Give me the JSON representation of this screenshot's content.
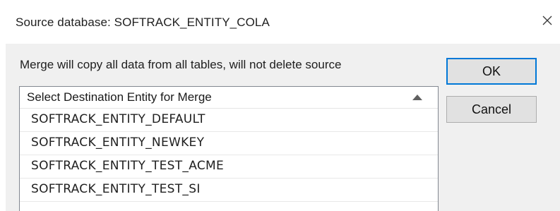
{
  "dialog": {
    "title": "Source database: SOFTRACK_ENTITY_COLA",
    "close_icon": "close-icon",
    "description": "Merge will copy all data from all tables, will not delete source",
    "ok_label": "OK",
    "cancel_label": "Cancel",
    "list": {
      "header": "Select Destination Entity for Merge",
      "sort_icon": "sort-ascending-icon",
      "items": [
        "SOFTRACK_ENTITY_DEFAULT",
        "SOFTRACK_ENTITY_NEWKEY",
        "SOFTRACK_ENTITY_TEST_ACME",
        "SOFTRACK_ENTITY_TEST_SI"
      ]
    },
    "colors": {
      "accent": "#0078d7",
      "client_bg": "#f0f0f0",
      "button_bg": "#e1e1e1"
    }
  }
}
